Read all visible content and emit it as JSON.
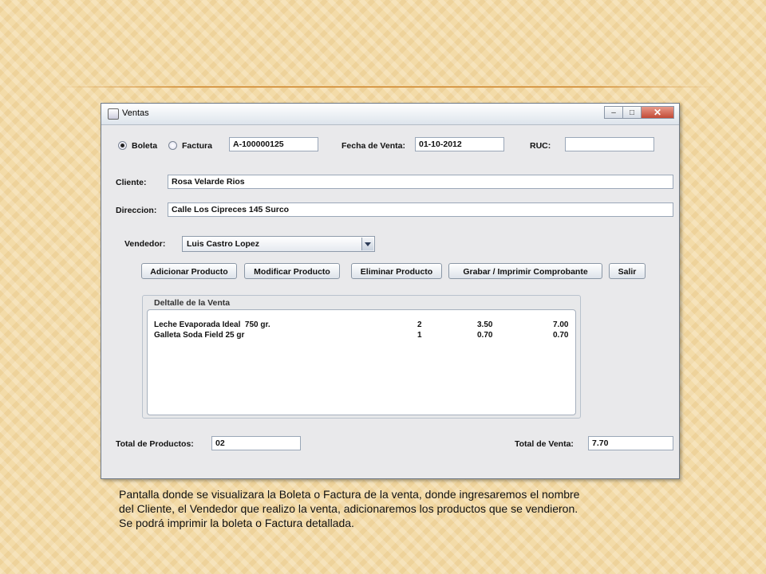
{
  "window": {
    "title": "Ventas"
  },
  "doc_type": {
    "option1": "Boleta",
    "option2": "Factura",
    "selected": "Boleta"
  },
  "header": {
    "serie_value": "A-100000125",
    "fecha_label": "Fecha de Venta:",
    "fecha_value": "01-10-2012",
    "ruc_label": "RUC:",
    "ruc_value": ""
  },
  "cliente": {
    "label": "Cliente:",
    "value": "Rosa Velarde Rios"
  },
  "direccion": {
    "label": "Direccion:",
    "value": "Calle Los Cipreces 145 Surco"
  },
  "vendedor": {
    "label": "Vendedor:",
    "value": "Luis Castro Lopez"
  },
  "buttons": {
    "adicionar": "Adicionar Producto",
    "modificar": "Modificar Producto",
    "eliminar": "Eliminar Producto",
    "grabar": "Grabar / Imprimir  Comprobante",
    "salir": "Salir"
  },
  "detalle": {
    "title": "Deltalle de la Venta",
    "rows": [
      {
        "producto": "Leche Evaporada Ideal  750 gr.",
        "cantidad": "2",
        "precio": "3.50",
        "total": "7.00"
      },
      {
        "producto": "Galleta Soda Field 25 gr",
        "cantidad": "1",
        "precio": "0.70",
        "total": "0.70"
      }
    ]
  },
  "totales": {
    "productos_label": "Total de Productos:",
    "productos_value": "02",
    "venta_label": "Total de Venta:",
    "venta_value": "7.70"
  },
  "caption": {
    "line1": "Pantalla donde se visualizara la Boleta o Factura de la venta, donde ingresaremos el nombre",
    "line2": "del Cliente, el Vendedor que realizo la venta, adicionaremos los productos que se vendieron.",
    "line3": "Se  podrá imprimir la boleta o Factura detallada."
  }
}
